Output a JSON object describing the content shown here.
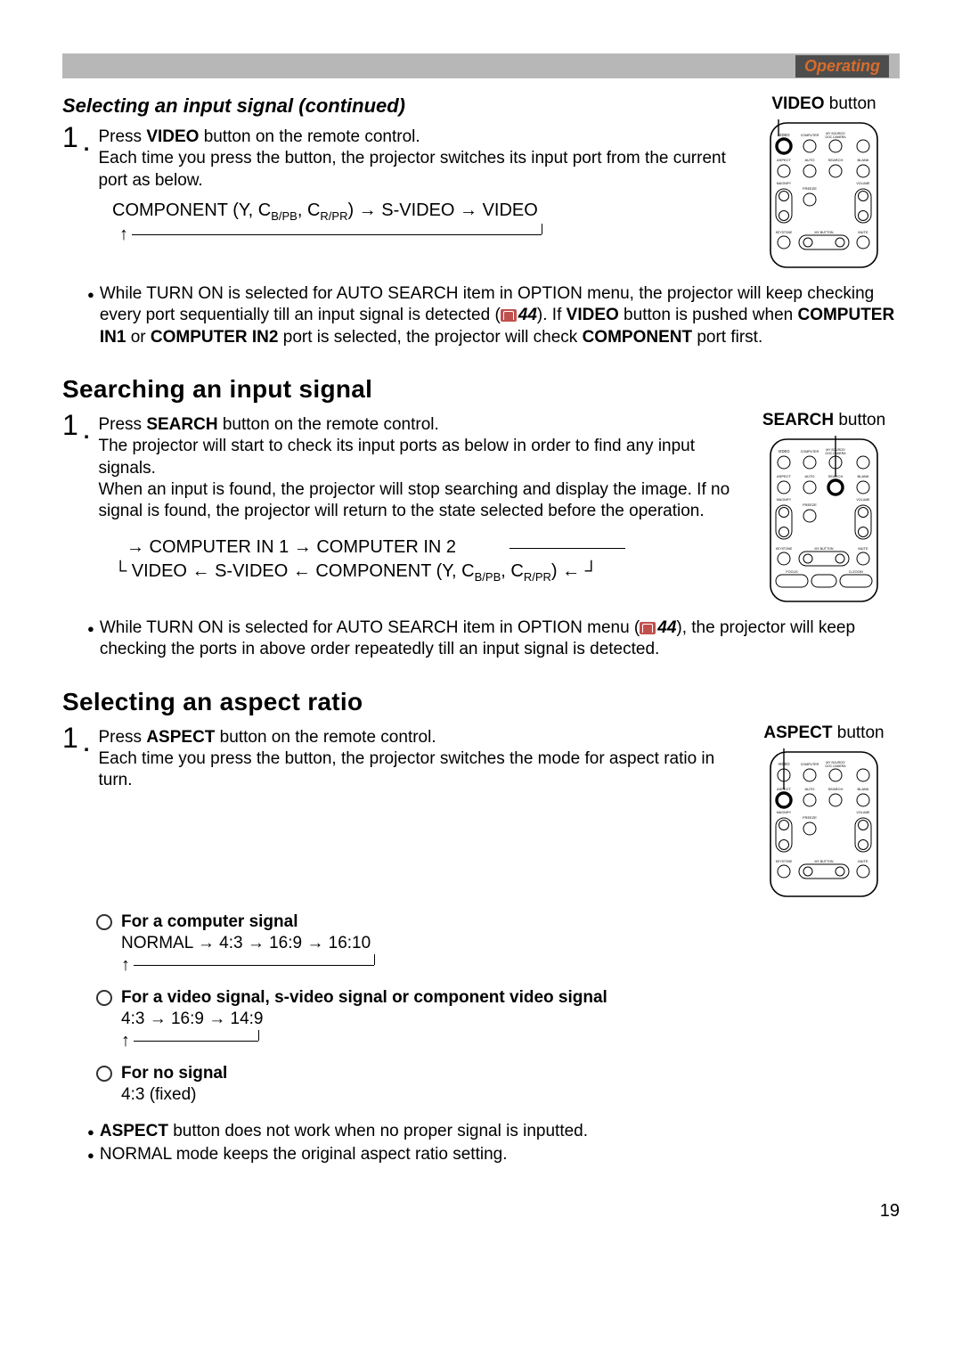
{
  "header": {
    "tag": "Operating"
  },
  "s1": {
    "title": "Selecting an input signal (continued)",
    "step_num": "1",
    "step_before1": "Press ",
    "step_bold1": "VIDEO",
    "step_after1": " button on the remote control.",
    "step_line2": "Each time you press the button, the projector switches its input port from the current port as below.",
    "flow_a": "COMPONENT (Y, C",
    "flow_bp": "B/P",
    "flow_bp2": "B",
    "flow_b": ", C",
    "flow_rp": "R/P",
    "flow_rp2": "R",
    "flow_c": ")  →  S-VIDEO  →  VIDEO",
    "note_a": "While TURN ON is selected for AUTO SEARCH item in OPTION menu, the projector will keep checking every port sequentially till an input signal is detected (",
    "note_ref": "44",
    "note_b": "). If ",
    "note_bold1": "VIDEO",
    "note_c": " button is pushed when ",
    "note_bold2": "COMPUTER IN1",
    "note_d": " or ",
    "note_bold3": "COMPUTER IN2",
    "note_e": " port is selected, the projector will check ",
    "note_bold4": "COMPONENT",
    "note_f": " port first.",
    "remote_label_pre": "VIDEO",
    "remote_label_post": " button"
  },
  "s2": {
    "title": "Searching an input signal",
    "step_num": "1",
    "step_before1": "Press ",
    "step_bold1": "SEARCH",
    "step_after1": " button on the remote control.",
    "step_line2": "The projector will start to check its input ports as below in order to find any input signals.",
    "step_line3": "When an input is found, the projector will stop searching and display the image. If no signal is found, the projector will return to the state selected before the operation.",
    "flow_r1_a": "→ COMPUTER IN 1  →  COMPUTER IN 2",
    "flow_r2_a": "VIDEO  ←  S-VIDEO  ←  COMPONENT (Y, C",
    "flow_bp": "B/P",
    "flow_bp2": "B",
    "flow_m": ", C",
    "flow_rp": "R/P",
    "flow_rp2": "R",
    "flow_r2_b": ")  ←",
    "note_a": "While TURN ON is selected for AUTO SEARCH item in OPTION menu (",
    "note_ref": "44",
    "note_b": "), the projector will keep checking the ports in above order repeatedly till an input signal is detected.",
    "remote_label_pre": "SEARCH",
    "remote_label_post": " button"
  },
  "s3": {
    "title": "Selecting an aspect ratio",
    "step_num": "1",
    "step_before1": "Press ",
    "step_bold1": "ASPECT",
    "step_after1": " button on the remote control.",
    "step_line2": "Each time you press the button, the projector switches the mode for aspect ratio in turn.",
    "case1_head": "For a computer signal",
    "case1_line": "NORMAL  →  4:3  →  16:9  →  16:10",
    "case2_head": "For a video signal, s-video signal or component video signal",
    "case2_line": "4:3  →  16:9  →  14:9",
    "case3_head": "For no signal",
    "case3_line": "4:3 (fixed)",
    "bullet1_bold": "ASPECT",
    "bullet1_rest": " button does not work when no proper signal is inputted.",
    "bullet2": "NORMAL mode keeps the original aspect ratio setting.",
    "remote_label_pre": "ASPECT",
    "remote_label_post": " button"
  },
  "remote_labels": {
    "row1": [
      "VIDEO",
      "COMPUTER",
      "MY SOURCE/ DOC.CAMERA"
    ],
    "row2": [
      "ASPECT",
      "AUTO",
      "SEARCH",
      "BLANK"
    ],
    "row3": [
      "MAGNIFY ON/OFF",
      "FREEZE",
      "VOLUME"
    ],
    "row4": [
      "KEYSTONE",
      "MY BUTTON",
      "MUTE"
    ],
    "row5": [
      "FOCUS",
      "D-ZOOM"
    ]
  },
  "page_number": "19"
}
